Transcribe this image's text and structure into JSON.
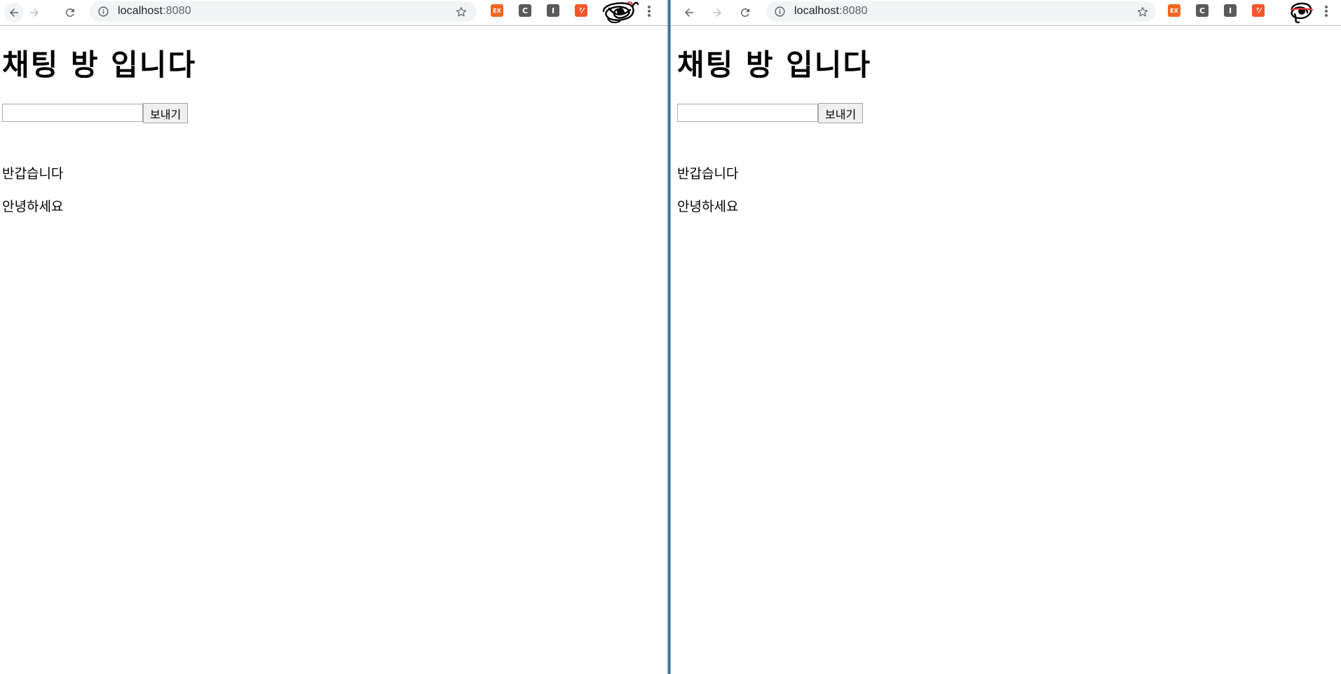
{
  "windows": [
    {
      "url_host": "localhost",
      "url_port": ":8080",
      "extensions": [
        {
          "icon": "ex-extension-icon",
          "label": "EX",
          "color": "#f26722"
        },
        {
          "icon": "c-extension-icon",
          "label": "C",
          "color": "#5a5a5a"
        },
        {
          "icon": "i-extension-icon",
          "label": "I",
          "color": "#5a5a5a"
        },
        {
          "icon": "percent-extension-icon",
          "label": "⁷⁄",
          "color": "#f2552c"
        }
      ],
      "page": {
        "heading": "채팅 방 입니다",
        "input_value": "",
        "send_label": "보내기",
        "messages": [
          "반갑습니다",
          "안녕하세요"
        ]
      }
    },
    {
      "url_host": "localhost",
      "url_port": ":8080",
      "extensions": [
        {
          "icon": "ex-extension-icon",
          "label": "EX",
          "color": "#f26722"
        },
        {
          "icon": "c-extension-icon",
          "label": "C",
          "color": "#5a5a5a"
        },
        {
          "icon": "i-extension-icon",
          "label": "I",
          "color": "#5a5a5a"
        },
        {
          "icon": "percent-extension-icon",
          "label": "⁷⁄",
          "color": "#f2552c"
        }
      ],
      "page": {
        "heading": "채팅 방 입니다",
        "input_value": "",
        "send_label": "보내기",
        "messages": [
          "반갑습니다",
          "안녕하세요"
        ]
      }
    }
  ],
  "colors": {
    "divider_accent": "#1a6fb0",
    "omnibox_bg": "#f1f3f4"
  }
}
